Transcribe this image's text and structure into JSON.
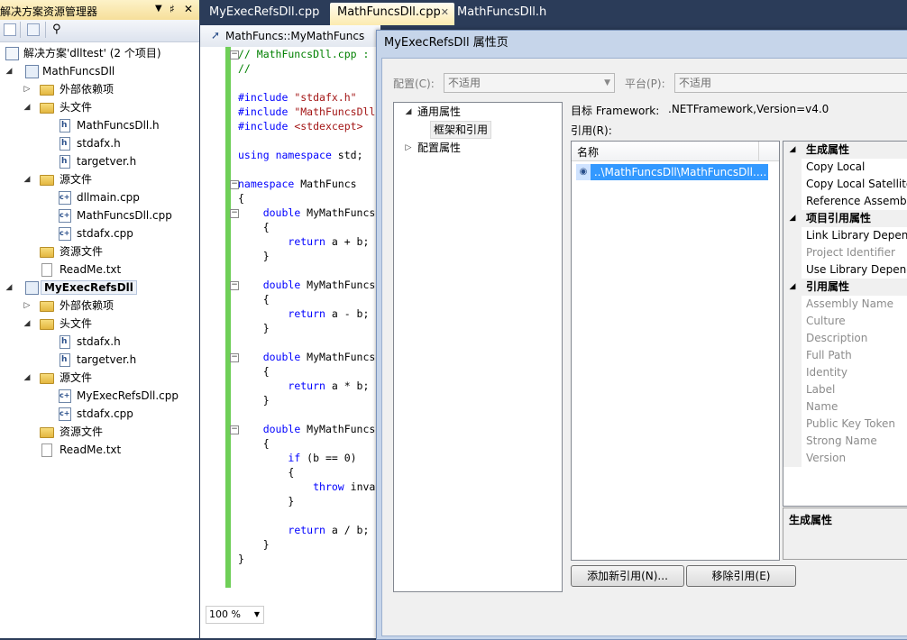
{
  "solution_explorer": {
    "title": "解决方案资源管理器",
    "title_controls": [
      "▼",
      "♯",
      "✕"
    ],
    "solution": "解决方案'dlltest' (2 个项目)",
    "projects": [
      {
        "name": "MathFuncsDll",
        "items": {
          "ext_deps": "外部依赖项",
          "headers": "头文件",
          "header_files": [
            "MathFuncsDll.h",
            "stdafx.h",
            "targetver.h"
          ],
          "sources": "源文件",
          "source_files": [
            "dllmain.cpp",
            "MathFuncsDll.cpp",
            "stdafx.cpp"
          ],
          "resources": "资源文件",
          "readme": "ReadMe.txt"
        }
      },
      {
        "name": "MyExecRefsDll",
        "items": {
          "ext_deps": "外部依赖项",
          "headers": "头文件",
          "header_files": [
            "stdafx.h",
            "targetver.h"
          ],
          "sources": "源文件",
          "source_files": [
            "MyExecRefsDll.cpp",
            "stdafx.cpp"
          ],
          "resources": "资源文件",
          "readme": "ReadMe.txt"
        }
      }
    ]
  },
  "tabs": [
    "MyExecRefsDll.cpp",
    "MathFuncsDll.cpp",
    "MathFuncsDll.h"
  ],
  "tab_close": "✕",
  "editor": {
    "nav_text": "MathFuncs::MyMathFuncs",
    "zoom": "100 %",
    "lines": [
      "// MathFuncsDll.cpp :",
      "//",
      "",
      "#include \"stdafx.h\"",
      "#include \"MathFuncsDll",
      "#include <stdexcept>",
      "",
      "using namespace std;",
      "",
      "namespace MathFuncs",
      "{",
      "    double MyMathFuncs",
      "    {",
      "        return a + b;",
      "    }",
      "",
      "    double MyMathFuncs",
      "    {",
      "        return a - b;",
      "    }",
      "",
      "    double MyMathFuncs",
      "    {",
      "        return a * b;",
      "    }",
      "",
      "    double MyMathFuncs",
      "    {",
      "        if (b == 0)",
      "        {",
      "            throw inva",
      "        }",
      "",
      "        return a / b;",
      "    }",
      "}"
    ]
  },
  "dialog": {
    "title": "MyExecRefsDll 属性页",
    "config_label": "配置(C):",
    "config_value": "不适用",
    "platform_label": "平台(P):",
    "platform_value": "不适用",
    "category_tree": {
      "common": "通用属性",
      "framework_refs": "框架和引用",
      "config": "配置属性"
    },
    "target_framework_label": "目标 Framework:",
    "target_framework_value": ".NETFramework,Version=v4.0",
    "refs_label": "引用(R):",
    "refs_column": "名称",
    "refs": [
      "..\\MathFuncsDll\\MathFuncsDll...."
    ],
    "add_button": "添加新引用(N)...",
    "remove_button": "移除引用(E)",
    "property_grid": [
      {
        "type": "cat",
        "text": "生成属性"
      },
      {
        "type": "item",
        "text": "Copy Local"
      },
      {
        "type": "item",
        "text": "Copy Local Satellite"
      },
      {
        "type": "item",
        "text": "Reference Assembl"
      },
      {
        "type": "cat",
        "text": "项目引用属性"
      },
      {
        "type": "item",
        "text": "Link Library Depend"
      },
      {
        "type": "gray",
        "text": "Project Identifier"
      },
      {
        "type": "item",
        "text": "Use Library Depend"
      },
      {
        "type": "cat",
        "text": "引用属性"
      },
      {
        "type": "gray",
        "text": "Assembly Name"
      },
      {
        "type": "gray",
        "text": "Culture"
      },
      {
        "type": "gray",
        "text": "Description"
      },
      {
        "type": "gray",
        "text": "Full Path"
      },
      {
        "type": "gray",
        "text": "Identity"
      },
      {
        "type": "gray",
        "text": "Label"
      },
      {
        "type": "gray",
        "text": "Name"
      },
      {
        "type": "gray",
        "text": "Public Key Token"
      },
      {
        "type": "gray",
        "text": "Strong Name"
      },
      {
        "type": "gray",
        "text": "Version"
      }
    ],
    "description_title": "生成属性"
  },
  "colors": {
    "ide_bg": "#2b3c59",
    "selection": "#3399ff",
    "keyword": "#0000ff",
    "comment": "#008000",
    "string": "#a31515",
    "change_bar": "#6fcf58"
  }
}
